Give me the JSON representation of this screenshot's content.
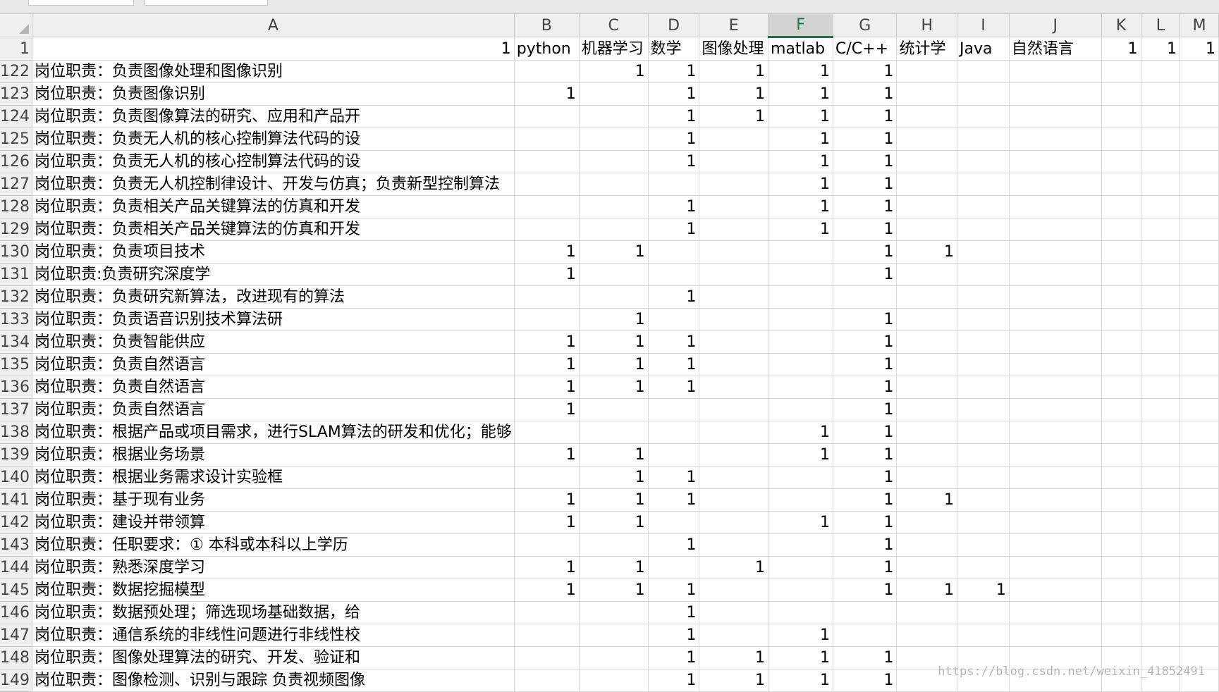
{
  "sheet": {
    "corner_icon": "select-all-triangle",
    "selected_column": "F",
    "columns": [
      {
        "letter": "A",
        "width": 268
      },
      {
        "letter": "B",
        "width": 103
      },
      {
        "letter": "C",
        "width": 102
      },
      {
        "letter": "D",
        "width": 103
      },
      {
        "letter": "E",
        "width": 101
      },
      {
        "letter": "F",
        "width": 103
      },
      {
        "letter": "G",
        "width": 102
      },
      {
        "letter": "H",
        "width": 103
      },
      {
        "letter": "I",
        "width": 102
      },
      {
        "letter": "J",
        "width": 180
      },
      {
        "letter": "K",
        "width": 103
      },
      {
        "letter": "L",
        "width": 102
      },
      {
        "letter": "M",
        "width": 100
      }
    ],
    "header_row": {
      "num": "1",
      "cells": [
        {
          "t": "1",
          "n": true
        },
        {
          "t": "python"
        },
        {
          "t": "机器学习"
        },
        {
          "t": "数学"
        },
        {
          "t": "图像处理"
        },
        {
          "t": "matlab"
        },
        {
          "t": "C/C++"
        },
        {
          "t": "统计学"
        },
        {
          "t": "Java"
        },
        {
          "t": "自然语言"
        },
        {
          "t": "1",
          "n": true
        },
        {
          "t": "1",
          "n": true
        },
        {
          "t": "1",
          "n": true
        }
      ]
    },
    "rows": [
      {
        "num": "122",
        "a": "岗位职责：负责图像处理和图像识别",
        "v": [
          "",
          "1",
          "1",
          "1",
          "1",
          "1",
          "",
          "",
          "",
          "",
          "",
          ""
        ]
      },
      {
        "num": "123",
        "a": "岗位职责：负责图像识别",
        "v": [
          "1",
          "",
          "1",
          "1",
          "1",
          "1",
          "",
          "",
          "",
          "",
          "",
          ""
        ]
      },
      {
        "num": "124",
        "a": "岗位职责：负责图像算法的研究、应用和产品开",
        "v": [
          "",
          "",
          "1",
          "1",
          "1",
          "1",
          "",
          "",
          "",
          "",
          "",
          ""
        ]
      },
      {
        "num": "125",
        "a": "岗位职责：负责无人机的核心控制算法代码的设",
        "v": [
          "",
          "",
          "1",
          "",
          "1",
          "1",
          "",
          "",
          "",
          "",
          "",
          ""
        ]
      },
      {
        "num": "126",
        "a": "岗位职责：负责无人机的核心控制算法代码的设",
        "v": [
          "",
          "",
          "1",
          "",
          "1",
          "1",
          "",
          "",
          "",
          "",
          "",
          ""
        ]
      },
      {
        "num": "127",
        "a": "岗位职责：负责无人机控制律设计、开发与仿真；负责新型控制算法",
        "v": [
          "",
          "",
          "",
          "",
          "1",
          "1",
          "",
          "",
          "",
          "",
          "",
          ""
        ]
      },
      {
        "num": "128",
        "a": "岗位职责：负责相关产品关键算法的仿真和开发",
        "v": [
          "",
          "",
          "1",
          "",
          "1",
          "1",
          "",
          "",
          "",
          "",
          "",
          ""
        ]
      },
      {
        "num": "129",
        "a": "岗位职责：负责相关产品关键算法的仿真和开发",
        "v": [
          "",
          "",
          "1",
          "",
          "1",
          "1",
          "",
          "",
          "",
          "",
          "",
          ""
        ]
      },
      {
        "num": "130",
        "a": "岗位职责：负责项目技术",
        "v": [
          "1",
          "1",
          "",
          "",
          "",
          "1",
          "1",
          "",
          "",
          "",
          "",
          ""
        ]
      },
      {
        "num": "131",
        "a": "岗位职责:负责研究深度学",
        "v": [
          "1",
          "",
          "",
          "",
          "",
          "1",
          "",
          "",
          "",
          "",
          "",
          ""
        ]
      },
      {
        "num": "132",
        "a": "岗位职责：负责研究新算法，改进现有的算法",
        "v": [
          "",
          "",
          "1",
          "",
          "",
          "",
          "",
          "",
          "",
          "",
          "",
          ""
        ]
      },
      {
        "num": "133",
        "a": "岗位职责：负责语音识别技术算法研",
        "v": [
          "",
          "1",
          "",
          "",
          "",
          "1",
          "",
          "",
          "",
          "",
          "",
          ""
        ]
      },
      {
        "num": "134",
        "a": "岗位职责：负责智能供应",
        "v": [
          "1",
          "1",
          "1",
          "",
          "",
          "1",
          "",
          "",
          "",
          "",
          "",
          ""
        ]
      },
      {
        "num": "135",
        "a": "岗位职责：负责自然语言",
        "v": [
          "1",
          "1",
          "1",
          "",
          "",
          "1",
          "",
          "",
          "",
          "",
          "",
          ""
        ]
      },
      {
        "num": "136",
        "a": "岗位职责：负责自然语言",
        "v": [
          "1",
          "1",
          "1",
          "",
          "",
          "1",
          "",
          "",
          "",
          "",
          "",
          ""
        ]
      },
      {
        "num": "137",
        "a": "岗位职责：负责自然语言",
        "v": [
          "1",
          "",
          "",
          "",
          "",
          "1",
          "",
          "",
          "",
          "",
          "",
          ""
        ]
      },
      {
        "num": "138",
        "a": "岗位职责：根据产品或项目需求，进行SLAM算法的研发和优化；能够",
        "v": [
          "",
          "",
          "",
          "",
          "1",
          "1",
          "",
          "",
          "",
          "",
          "",
          ""
        ]
      },
      {
        "num": "139",
        "a": "岗位职责：根据业务场景",
        "v": [
          "1",
          "1",
          "",
          "",
          "1",
          "1",
          "",
          "",
          "",
          "",
          "",
          ""
        ]
      },
      {
        "num": "140",
        "a": "岗位职责：根据业务需求设计实验框",
        "v": [
          "",
          "1",
          "1",
          "",
          "",
          "1",
          "",
          "",
          "",
          "",
          "",
          ""
        ]
      },
      {
        "num": "141",
        "a": "岗位职责：基于现有业务",
        "v": [
          "1",
          "1",
          "1",
          "",
          "",
          "1",
          "1",
          "",
          "",
          "",
          "",
          ""
        ]
      },
      {
        "num": "142",
        "a": "岗位职责：建设并带领算",
        "v": [
          "1",
          "1",
          "",
          "",
          "1",
          "1",
          "",
          "",
          "",
          "",
          "",
          ""
        ]
      },
      {
        "num": "143",
        "a": "岗位职责：任职要求：① 本科或本科以上学历",
        "v": [
          "",
          "",
          "1",
          "",
          "",
          "1",
          "",
          "",
          "",
          "",
          "",
          ""
        ]
      },
      {
        "num": "144",
        "a": "岗位职责：熟悉深度学习",
        "v": [
          "1",
          "1",
          "",
          "1",
          "",
          "1",
          "",
          "",
          "",
          "",
          "",
          ""
        ]
      },
      {
        "num": "145",
        "a": "岗位职责：数据挖掘模型",
        "v": [
          "1",
          "1",
          "1",
          "",
          "",
          "1",
          "1",
          "1",
          "",
          "",
          "",
          ""
        ]
      },
      {
        "num": "146",
        "a": "岗位职责：数据预处理；筛选现场基础数据，给",
        "v": [
          "",
          "",
          "1",
          "",
          "",
          "",
          "",
          "",
          "",
          "",
          "",
          ""
        ]
      },
      {
        "num": "147",
        "a": "岗位职责：通信系统的非线性问题进行非线性校",
        "v": [
          "",
          "",
          "1",
          "",
          "1",
          "",
          "",
          "",
          "",
          "",
          "",
          ""
        ]
      },
      {
        "num": "148",
        "a": "岗位职责：图像处理算法的研究、开发、验证和",
        "v": [
          "",
          "",
          "1",
          "1",
          "1",
          "1",
          "",
          "",
          "",
          "",
          "",
          ""
        ]
      },
      {
        "num": "149",
        "a": "岗位职责：图像检测、识别与跟踪 负责视频图像",
        "v": [
          "",
          "",
          "1",
          "1",
          "1",
          "1",
          "",
          "",
          "",
          "",
          "",
          ""
        ]
      }
    ]
  },
  "watermark": "https://blog.csdn.net/weixin_41852491"
}
